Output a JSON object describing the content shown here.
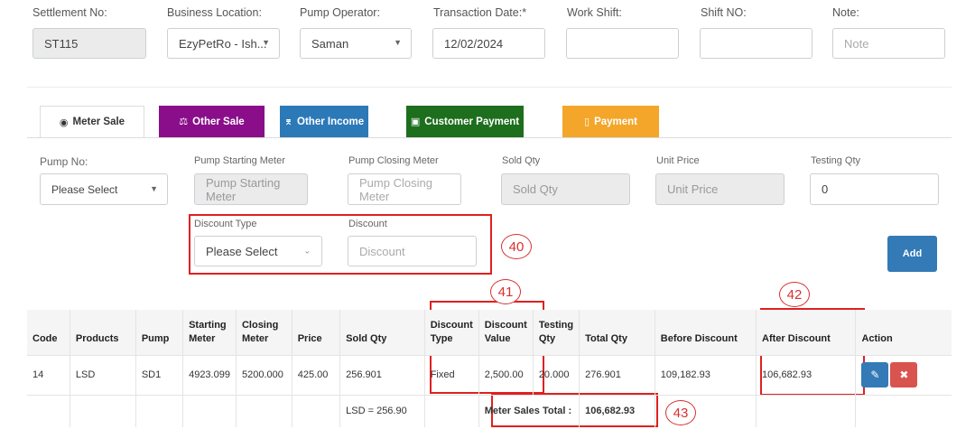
{
  "header": {
    "settlement_no": {
      "label": "Settlement No:",
      "value": "ST115"
    },
    "business_location": {
      "label": "Business Location:",
      "value": "EzyPetRo - Ish..."
    },
    "pump_operator": {
      "label": "Pump Operator:",
      "value": "Saman"
    },
    "transaction_date": {
      "label": "Transaction Date:*",
      "value": "12/02/2024"
    },
    "work_shift": {
      "label": "Work Shift:",
      "value": ""
    },
    "shift_no": {
      "label": "Shift NO:",
      "value": ""
    },
    "note": {
      "label": "Note:",
      "placeholder": "Note"
    }
  },
  "tabs": [
    {
      "label": "Meter Sale",
      "icon": "dashboard-icon",
      "color": "#ffffff"
    },
    {
      "label": "Other Sale",
      "icon": "balance-scale-icon",
      "color": "#8a0e8a"
    },
    {
      "label": "Other Income",
      "icon": "thermometer-icon",
      "color": "#2c79b8"
    },
    {
      "label": "Customer Payment",
      "icon": "money-bill-icon",
      "color": "#1d6e1d"
    },
    {
      "label": "Payment",
      "icon": "credit-card-icon",
      "color": "#f4a62a"
    }
  ],
  "form": {
    "pump_no": {
      "label": "Pump No:",
      "value": "Please Select"
    },
    "pump_starting_meter": {
      "label": "Pump Starting Meter",
      "placeholder": "Pump Starting Meter"
    },
    "pump_closing_meter": {
      "label": "Pump Closing Meter",
      "placeholder": "Pump Closing Meter"
    },
    "sold_qty": {
      "label": "Sold Qty",
      "placeholder": "Sold Qty"
    },
    "unit_price": {
      "label": "Unit Price",
      "placeholder": "Unit Price"
    },
    "testing_qty": {
      "label": "Testing Qty",
      "value": "0"
    },
    "discount_type": {
      "label": "Discount Type",
      "value": "Please Select"
    },
    "discount": {
      "label": "Discount",
      "placeholder": "Discount"
    },
    "add_button": "Add"
  },
  "callouts": {
    "c40": "40",
    "c41": "41",
    "c42": "42",
    "c43": "43"
  },
  "table": {
    "headers": {
      "code": "Code",
      "products": "Products",
      "pump": "Pump",
      "starting_1": "Starting",
      "starting_2": "Meter",
      "closing_1": "Closing",
      "closing_2": "Meter",
      "price": "Price",
      "sold_qty": "Sold Qty",
      "dtype_1": "Discount",
      "dtype_2": "Type",
      "dvalue_1": "Discount",
      "dvalue_2": "Value",
      "testing_1": "Testing",
      "testing_2": "Qty",
      "total_qty": "Total Qty",
      "before_discount": "Before Discount",
      "after_discount": "After Discount",
      "action": "Action"
    },
    "rows": [
      {
        "code": "14",
        "products": "LSD",
        "pump": "SD1",
        "starting_meter": "4923.099",
        "closing_meter": "5200.000",
        "price": "425.00",
        "sold_qty": "256.901",
        "discount_type": "Fixed",
        "discount_value": "2,500.00",
        "testing_qty": "20.000",
        "total_qty": "276.901",
        "before_discount": "109,182.93",
        "after_discount": "106,682.93"
      }
    ],
    "footer": {
      "product_total": "LSD = 256.90",
      "total_label": "Meter Sales Total :",
      "total_value": "106,682.93"
    }
  },
  "colors": {
    "primary": "#337ab7",
    "danger": "#d9534f",
    "annotation": "#e02020"
  }
}
